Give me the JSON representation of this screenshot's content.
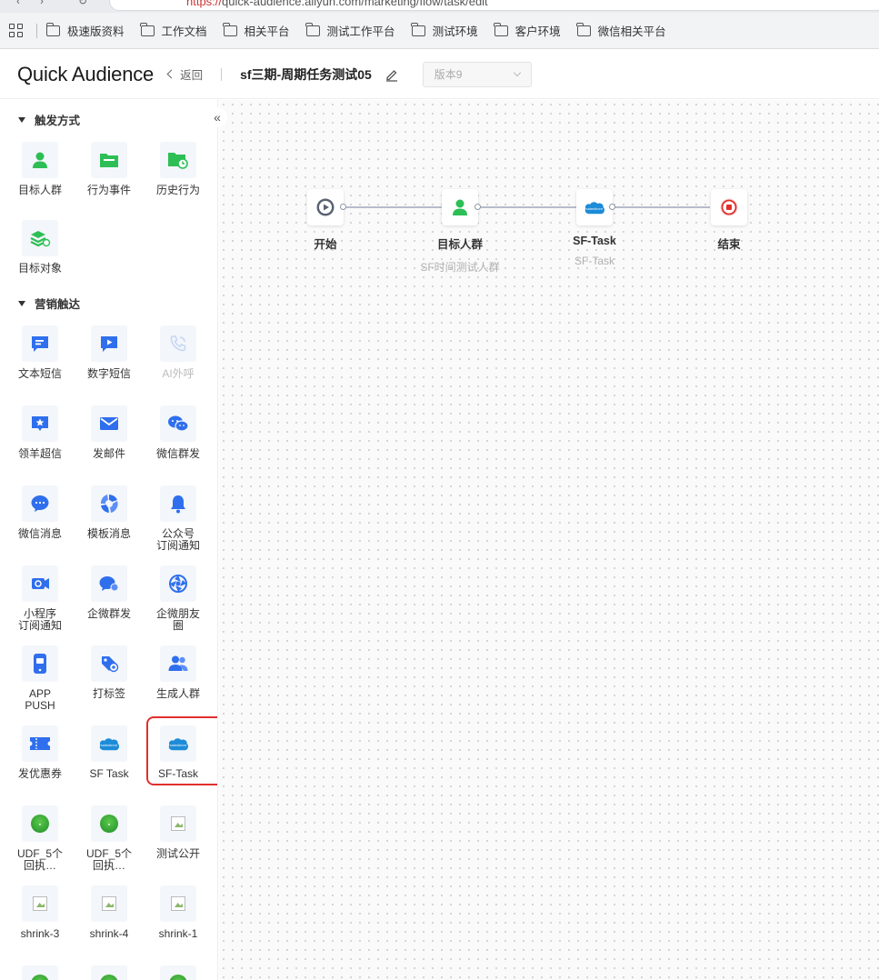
{
  "browser": {
    "url_scheme": "https://",
    "url_rest": "quick-audience.aliyun.com/marketing/flow/task/edit",
    "bookmarks": [
      "极速版资料",
      "工作文档",
      "相关平台",
      "测试工作平台",
      "测试环境",
      "客户环境",
      "微信相关平台"
    ]
  },
  "header": {
    "logo": "Quick Audience",
    "back_label": "返回",
    "task_title": "sf三期-周期任务测试05",
    "version": "版本9"
  },
  "sidebar": {
    "collapse_glyph": "«",
    "sections": [
      {
        "title": "触发方式",
        "items": [
          {
            "label": "目标人群",
            "icon": "user-icon"
          },
          {
            "label": "行为事件",
            "icon": "folder-event-icon"
          },
          {
            "label": "历史行为",
            "icon": "history-folder-icon"
          },
          {
            "label": "目标对象",
            "icon": "target-object-icon"
          }
        ]
      },
      {
        "title": "营销触达",
        "items": [
          {
            "label": "文本短信",
            "icon": "text-sms-icon"
          },
          {
            "label": "数字短信",
            "icon": "digital-sms-icon"
          },
          {
            "label": "AI外呼",
            "icon": "ai-call-icon",
            "disabled": true
          },
          {
            "label": "领羊超信",
            "icon": "super-message-icon"
          },
          {
            "label": "发邮件",
            "icon": "mail-icon"
          },
          {
            "label": "微信群发",
            "icon": "wechat-group-icon"
          },
          {
            "label": "微信消息",
            "icon": "wechat-message-icon"
          },
          {
            "label": "模板消息",
            "icon": "template-message-icon"
          },
          {
            "label": "公众号\n订阅通知",
            "icon": "bell-icon"
          },
          {
            "label": "小程序\n订阅通知",
            "icon": "mini-program-icon"
          },
          {
            "label": "企微群发",
            "icon": "wecom-group-icon"
          },
          {
            "label": "企微朋友\n圈",
            "icon": "wecom-moments-icon"
          },
          {
            "label": "APP\nPUSH",
            "icon": "phone-icon"
          },
          {
            "label": "打标签",
            "icon": "tag-icon"
          },
          {
            "label": "生成人群",
            "icon": "group-users-icon"
          },
          {
            "label": "发优惠券",
            "icon": "coupon-icon"
          },
          {
            "label": "SF Task",
            "icon": "salesforce-icon"
          },
          {
            "label": "SF-Task",
            "icon": "salesforce-icon"
          },
          {
            "label": "UDF_5个\n回执…",
            "icon": "green-ball-icon"
          },
          {
            "label": "UDF_5个\n回执…",
            "icon": "green-ball-icon"
          },
          {
            "label": "测试公开",
            "icon": "broken-image-icon"
          },
          {
            "label": "shrink-3",
            "icon": "broken-image-icon"
          },
          {
            "label": "shrink-4",
            "icon": "broken-image-icon"
          },
          {
            "label": "shrink-1",
            "icon": "broken-image-icon"
          },
          {
            "label": "",
            "icon": "green-ball-icon"
          },
          {
            "label": "",
            "icon": "green-ball-icon"
          },
          {
            "label": "",
            "icon": "green-ball-icon"
          }
        ]
      }
    ]
  },
  "flow": {
    "nodes": [
      {
        "label": "开始",
        "sub": "",
        "icon": "play-icon"
      },
      {
        "label": "目标人群",
        "sub": "SF时间测试人群",
        "icon": "user-icon"
      },
      {
        "label": "SF-Task",
        "sub": "SF-Task",
        "icon": "salesforce-icon"
      },
      {
        "label": "结束",
        "sub": "",
        "icon": "stop-icon"
      }
    ]
  },
  "colors": {
    "green": "#2dbf56",
    "blue": "#2f6fed",
    "red": "#e0302d",
    "highlight": "#e0302d"
  }
}
